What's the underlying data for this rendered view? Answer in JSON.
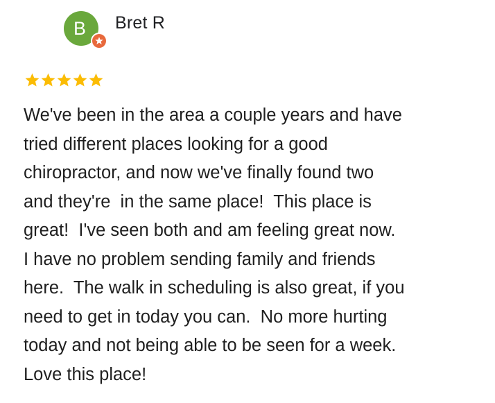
{
  "reviewer": {
    "initial": "B",
    "name": "Bret R",
    "avatar_color": "#6aa83c",
    "badge_icon": "local-guide-star-icon",
    "badge_color": "#e8693c"
  },
  "rating": {
    "stars": 5,
    "max_stars": 5,
    "star_color": "#fbbc04",
    "icon": "star-icon"
  },
  "review": {
    "lines": [
      "We've been in the area a couple years and have",
      "tried different places looking for a good",
      "chiropractor, and now we've finally found two",
      "and they're  in the same place!  This place is",
      "great!  I've seen both and am feeling great now.",
      "I have no problem sending family and friends",
      "here.  The walk in scheduling is also great, if you",
      "need to get in today you can.  No more hurting",
      "today and not being able to be seen for a week.",
      "Love this place!"
    ]
  }
}
